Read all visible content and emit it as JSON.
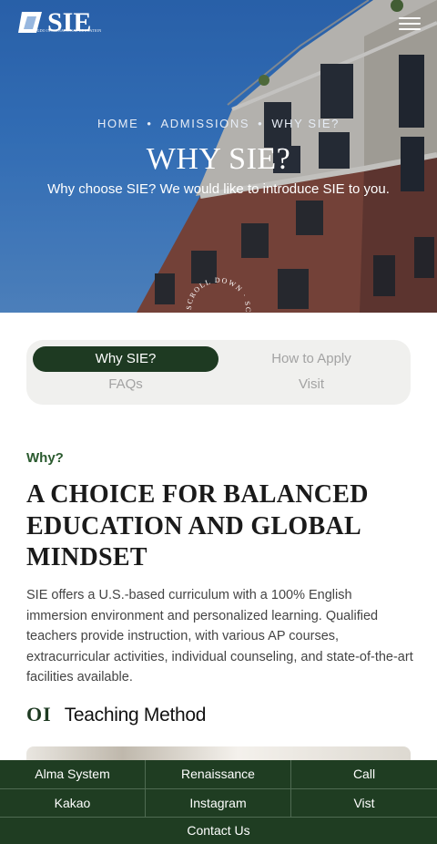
{
  "header": {
    "logo_text": "SIE",
    "logo_subtext": "SONGDO INTERNATIONAL EDUCATION",
    "menu_icon": "hamburger-icon"
  },
  "hero": {
    "breadcrumb": [
      "HOME",
      "ADMISSIONS",
      "WHY SIE?"
    ],
    "title": "WHY SIE?",
    "subtitle": "Why choose SIE? We would like to introduce SIE to you.",
    "scroll_text": "SCROLL DOWN · SCROLL DOWN ·"
  },
  "tabs": [
    {
      "label": "Why SIE?",
      "active": true
    },
    {
      "label": "How to Apply",
      "active": false
    },
    {
      "label": "FAQs",
      "active": false
    },
    {
      "label": "Visit",
      "active": false
    }
  ],
  "content": {
    "eyebrow": "Why?",
    "heading": "A CHOICE FOR BALANCED EDUCATION AND GLOBAL MINDSET",
    "body": "SIE offers a U.S.-based curriculum with a 100% English immersion environment and personalized learning. Qualified teachers provide instruction, with various AP courses, extracurricular activities, individual counseling, and state-of-the-art facilities available.",
    "section_number": "OI",
    "section_title": "Teaching Method"
  },
  "bottom_bar": {
    "row1": [
      "Alma System",
      "Renaissance",
      "Call"
    ],
    "row2": [
      "Kakao",
      "Instagram",
      "Vist"
    ],
    "row3": "Contact Us"
  },
  "colors": {
    "primary_green": "#1e3a22",
    "bar_green": "#1f3d22",
    "tab_bg": "#f0f0ee",
    "sky_blue": "#3b7fcf"
  }
}
